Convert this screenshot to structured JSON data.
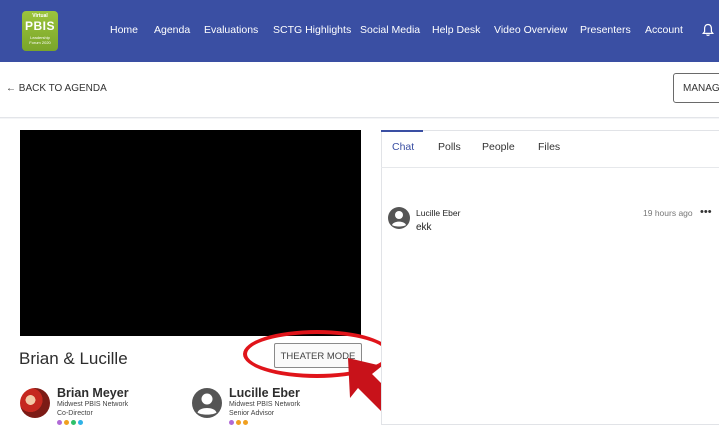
{
  "logo": {
    "top": "Virtual",
    "main": "PBIS",
    "sub": "Leadership Forum 2020"
  },
  "nav": {
    "items": [
      "Home",
      "Agenda",
      "Evaluations",
      "SCTG Highlights",
      "Social Media",
      "Help Desk",
      "Video Overview",
      "Presenters",
      "Account"
    ],
    "bell_icon": "bell-icon"
  },
  "subheader": {
    "back_label": "← BACK TO AGENDA",
    "manage_label": "MANAGE"
  },
  "session": {
    "title": "Brian & Lucille",
    "theater_mode_label": "THEATER MODE"
  },
  "presenters": [
    {
      "name": "Brian Meyer",
      "org": "Midwest PBIS Network",
      "role": "Co-Director",
      "dot_colors": [
        "#b06ad6",
        "#f0a020",
        "#2ec06a",
        "#2fb2e6"
      ]
    },
    {
      "name": "Lucille Eber",
      "org": "Midwest PBIS Network",
      "role": "Senior Advisor",
      "dot_colors": [
        "#b06ad6",
        "#f0a020",
        "#f0a020"
      ]
    }
  ],
  "chat_panel": {
    "tabs": [
      "Chat",
      "Polls",
      "People",
      "Files"
    ],
    "active_tab": "Chat",
    "messages": [
      {
        "author": "Lucille Eber",
        "text": "ekk",
        "time": "19 hours ago",
        "more": "•••"
      }
    ]
  },
  "colors": {
    "nav_bg": "#3a4fa3",
    "accent": "#3a4fa3",
    "annotation_red": "#e0141a",
    "arrow_red": "#c8121a"
  }
}
